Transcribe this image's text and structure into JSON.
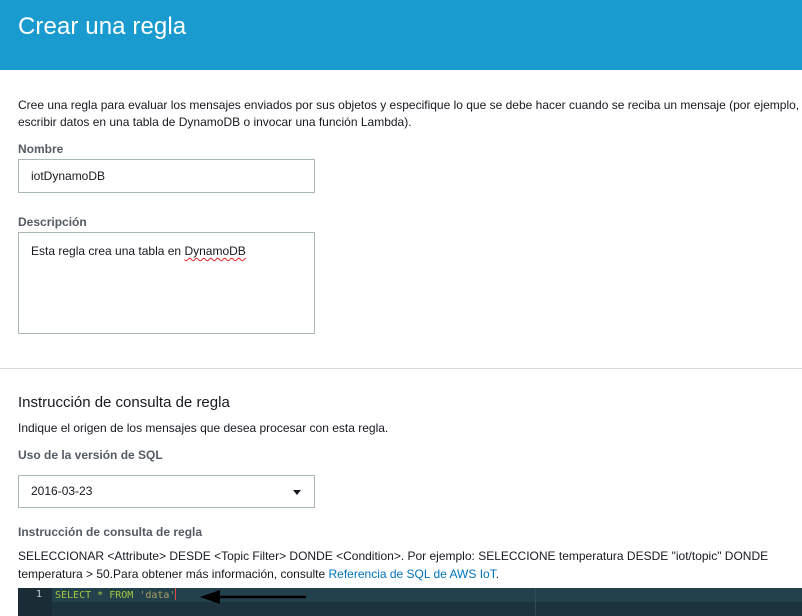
{
  "page": {
    "title": "Crear una regla",
    "intro": "Cree una regla para evaluar los mensajes enviados por sus objetos y especifique lo que se debe hacer cuando se reciba un mensaje (por ejemplo, escribir datos en una tabla de DynamoDB o invocar una función Lambda)."
  },
  "form": {
    "name_label": "Nombre",
    "name_value": "iotDynamoDB",
    "description_label": "Descripción",
    "description_prefix": "Esta regla crea una tabla en ",
    "description_word": "DynamoDB"
  },
  "query_section": {
    "title": "Instrucción de consulta de regla",
    "subtitle": "Indique el origen de los mensajes que desea procesar con esta regla.",
    "sql_version_label": "Uso de la versión de SQL",
    "sql_version_value": "2016-03-23",
    "query_label": "Instrucción de consulta de regla",
    "help_text": "SELECCIONAR <Attribute> DESDE <Topic Filter> DONDE <Condition>. Por ejemplo: SELECCIONE temperatura DESDE \"iot/topic\" DONDE temperatura > 50.Para obtener más información, consulte ",
    "help_link": "Referencia de SQL de AWS IoT",
    "help_end": "."
  },
  "editor": {
    "line_number": "1",
    "kw_select": "SELECT",
    "star": " * ",
    "kw_from": "FROM",
    "space": " ",
    "string": "'data'"
  },
  "colors": {
    "header_bg": "#1a9bd0",
    "link": "#0073bb",
    "editor_bg": "#1d343f",
    "keyword": "#a4c639"
  },
  "icons": {
    "dropdown": "caret-down-icon",
    "annotation": "arrow-left-icon"
  }
}
